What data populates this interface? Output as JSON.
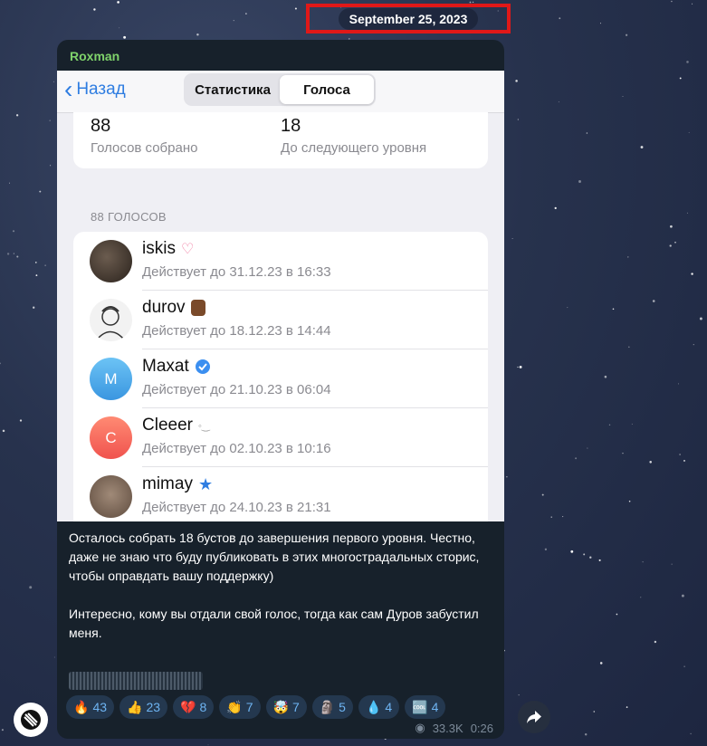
{
  "date": "September 25, 2023",
  "sender": "Roxman",
  "nav": {
    "back_label": "Назад",
    "tabs": [
      "Статистика",
      "Голоса"
    ],
    "active_tab": "Голоса"
  },
  "stats": {
    "collected_value": "88",
    "collected_label": "Голосов собрано",
    "next_value": "18",
    "next_label": "До следующего уровня"
  },
  "section_title": "88 ГОЛОСОВ",
  "voters": [
    {
      "name": "iskis",
      "expires": "Действует до 31.12.23 в 16:33"
    },
    {
      "name": "durov",
      "expires": "Действует до 18.12.23 в 14:44"
    },
    {
      "name": "Maxat",
      "initial": "M",
      "expires": "Действует до 21.10.23 в 06:04"
    },
    {
      "name": "Cleeer",
      "initial": "C",
      "expires": "Действует до 02.10.23 в 10:16"
    },
    {
      "name": "mimay",
      "expires": "Действует до 24.10.23 в 21:31"
    }
  ],
  "caption": {
    "p1": "Осталось собрать 18 бустов до завершения первого уровня. Честно, даже не знаю что буду публиковать в этих многострадальных сторис, чтобы оправдать вашу поддержку)",
    "p2": "Интересно, кому вы отдали свой голос, тогда как сам Дуров забустил меня."
  },
  "reactions": [
    {
      "emoji": "🔥",
      "count": "43"
    },
    {
      "emoji": "👍",
      "count": "23"
    },
    {
      "emoji": "💔",
      "count": "8"
    },
    {
      "emoji": "👏",
      "count": "7"
    },
    {
      "emoji": "🤯",
      "count": "7"
    },
    {
      "emoji": "🗿",
      "count": "5"
    },
    {
      "emoji": "💧",
      "count": "4"
    },
    {
      "emoji": "🆒",
      "count": "4"
    }
  ],
  "meta": {
    "views": "33.3K",
    "time": "0:26"
  },
  "colors": {
    "accent": "#2f7de1",
    "sender": "#7fd36b",
    "highlight": "#e01818"
  }
}
